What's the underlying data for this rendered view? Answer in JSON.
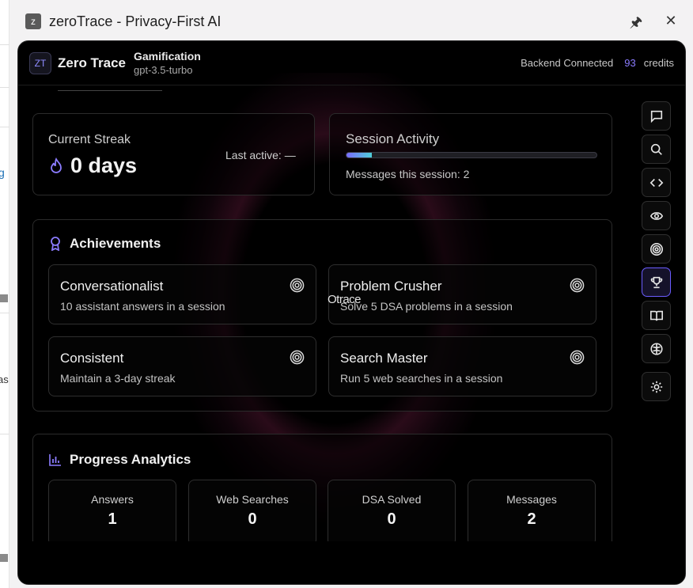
{
  "window": {
    "badge": "z",
    "title": "zeroTrace - Privacy-First AI",
    "pin_icon": "pin-icon",
    "close_icon": "close-icon"
  },
  "header": {
    "logo": "ZT",
    "brand": "Zero Trace",
    "mode": "Gamification",
    "model": "gpt-3.5-turbo",
    "status": "Backend Connected",
    "credits_value": "93",
    "credits_label": "credits"
  },
  "streak": {
    "label": "Current Streak",
    "value": "0 days",
    "last_active": "Last active: —"
  },
  "session": {
    "label": "Session Activity",
    "progress_fraction": 0.1,
    "messages": "Messages this session: 2"
  },
  "achievements": {
    "title": "Achievements",
    "items": [
      {
        "name": "Conversationalist",
        "desc": "10 assistant answers in a session"
      },
      {
        "name": "Problem Crusher",
        "desc": "Solve 5 DSA problems in a session"
      },
      {
        "name": "Consistent",
        "desc": "Maintain a 3-day streak"
      },
      {
        "name": "Search Master",
        "desc": "Run 5 web searches in a session"
      }
    ],
    "overlay_text": "Otrace"
  },
  "progress": {
    "title": "Progress Analytics",
    "stats": [
      {
        "label": "Answers",
        "value": "1"
      },
      {
        "label": "Web Searches",
        "value": "0"
      },
      {
        "label": "DSA Solved",
        "value": "0"
      },
      {
        "label": "Messages",
        "value": "2"
      }
    ]
  },
  "sidebar": {
    "icons": [
      "chat-icon",
      "search-icon",
      "code-icon",
      "eye-icon",
      "target-icon",
      "trophy-icon",
      "book-icon",
      "brain-icon",
      "gear-icon"
    ],
    "active": "trophy-icon"
  },
  "colors": {
    "accent": "#8b7cff",
    "background": "#000000"
  }
}
